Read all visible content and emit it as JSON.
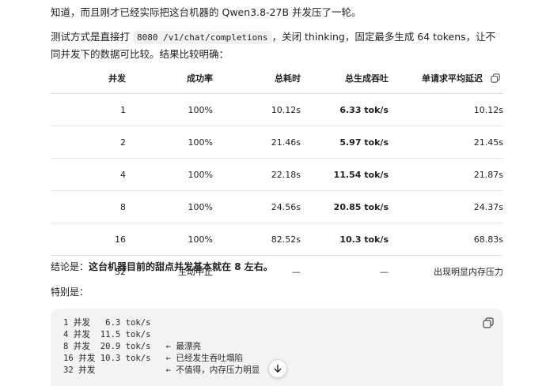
{
  "intro": {
    "line1": "知道，而且刚才已经实际把这台机器的 Qwen3.8-27B 并发压了一轮。",
    "line2_pre": "测试方式是直接打 ",
    "line2_code": "8080 /v1/chat/completions",
    "line2_post": "，关闭 thinking，固定最多生成 64 tokens，让不同并发下的数据可比较。结果比较明确："
  },
  "table": {
    "headers": [
      "并发",
      "成功率",
      "总耗时",
      "总生成吞吐",
      "单请求平均延迟"
    ],
    "rows": [
      [
        "1",
        "100%",
        "10.12s",
        "6.33 tok/s",
        "10.12s"
      ],
      [
        "2",
        "100%",
        "21.46s",
        "5.97 tok/s",
        "21.45s"
      ],
      [
        "4",
        "100%",
        "22.18s",
        "11.54 tok/s",
        "21.87s"
      ],
      [
        "8",
        "100%",
        "24.56s",
        "20.85 tok/s",
        "24.37s"
      ],
      [
        "16",
        "100%",
        "82.52s",
        "10.3 tok/s",
        "68.83s"
      ],
      [
        "32",
        "主动中止",
        "—",
        "—",
        "出现明显内存压力"
      ]
    ]
  },
  "conclusion": {
    "prefix": "结论是：",
    "bold": "这台机器目前的甜点并发基本就在 8 左右。"
  },
  "note": "特别是：",
  "code": {
    "lines": [
      "1 并发   6.3 tok/s",
      "4 并发  11.5 tok/s",
      "8 并发  20.9 tok/s   ← 最漂亮",
      "16 并发 10.3 tok/s   ← 已经发生吞吐塌陷",
      "32 并发              ← 不值得，内存压力明显"
    ]
  },
  "icons": {
    "table_copy": "copy-icon",
    "code_copy": "copy-icon",
    "scroll": "arrow-down-icon"
  }
}
